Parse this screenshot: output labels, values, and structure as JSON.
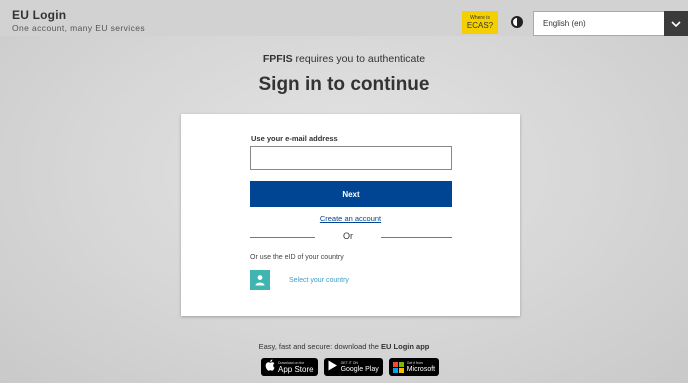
{
  "header": {
    "title": "EU Login",
    "subtitle": "One account, many EU services",
    "ecas_small": "Where is",
    "ecas_big": "ECAS?",
    "language": "English (en)"
  },
  "auth": {
    "service": "FPFIS",
    "message": " requires you to authenticate",
    "title": "Sign in to continue"
  },
  "form": {
    "email_label": "Use your e-mail address",
    "email_value": "",
    "next_label": "Next",
    "create_account": "Create an account",
    "or": "Or",
    "eid_text": "Or use the eID of your country",
    "select_country": "Select your country"
  },
  "footer": {
    "app_text_prefix": "Easy, fast and secure: download the ",
    "app_text_bold": "EU Login app",
    "badges": [
      {
        "small": "Download on the",
        "big": "App Store",
        "icon": "apple-icon"
      },
      {
        "small": "GET IT ON",
        "big": "Google Play",
        "icon": "google-play-icon"
      },
      {
        "small": "Get it from",
        "big": "Microsoft",
        "icon": "microsoft-icon"
      }
    ]
  },
  "colors": {
    "primary": "#004494",
    "ecas": "#f5d000",
    "eid": "#3fb4b0",
    "link": "#3a9fc8"
  }
}
